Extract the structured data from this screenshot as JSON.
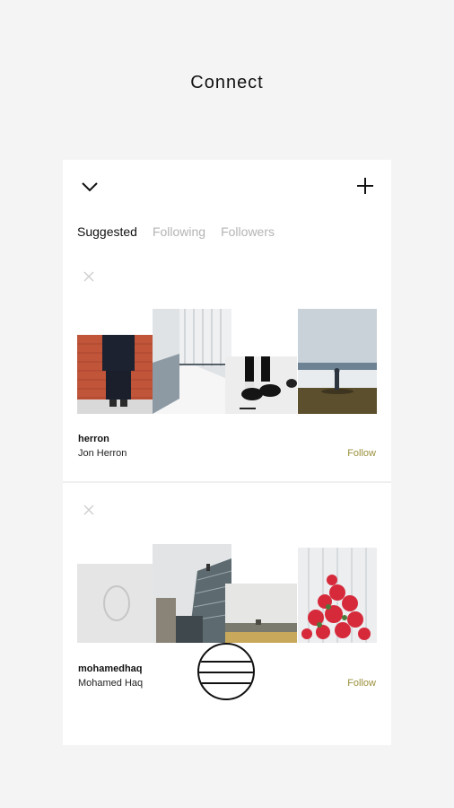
{
  "header": {
    "title": "Connect"
  },
  "tabs": [
    {
      "label": "Suggested",
      "active": true
    },
    {
      "label": "Following",
      "active": false
    },
    {
      "label": "Followers",
      "active": false
    }
  ],
  "users": [
    {
      "username": "herron",
      "full_name": "Jon Herron",
      "follow_label": "Follow"
    },
    {
      "username": "mohamedhaq",
      "full_name": "Mohamed Haq",
      "follow_label": "Follow"
    }
  ],
  "icons": {
    "collapse": "chevron-down-icon",
    "add": "plus-icon",
    "dismiss": "close-icon",
    "menu": "menu-icon"
  },
  "colors": {
    "follow": "#9a8f3a",
    "background": "#f4f4f4"
  }
}
